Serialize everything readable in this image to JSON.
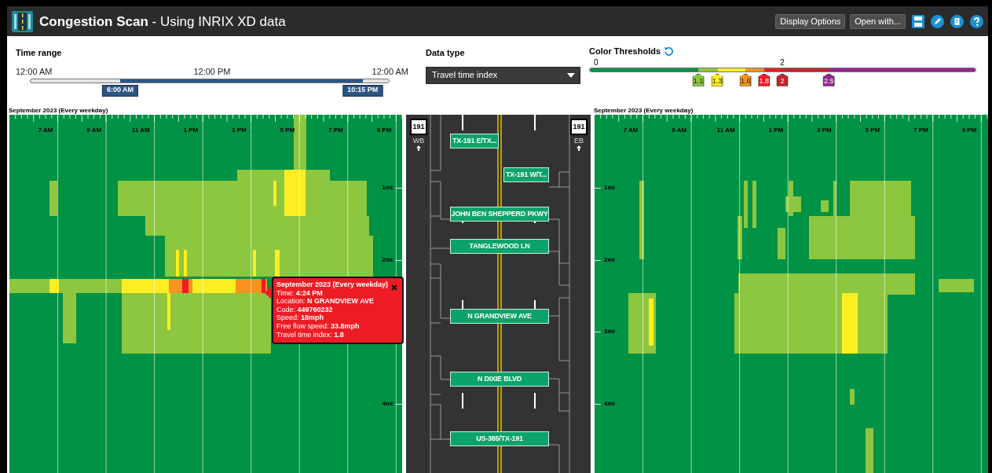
{
  "header": {
    "title": "**Congestion Scan** - Using INRIX XD data",
    "buttons": [
      "Display Options",
      "Open with..."
    ]
  },
  "time_range": {
    "label": "Time range",
    "axis_labels": [
      "12:00 AM",
      "12:00 PM",
      "12:00 AM"
    ],
    "handles": [
      {
        "label": "6:00 AM",
        "level": 0.25
      },
      {
        "label": "10:15 PM",
        "level": 0.927
      }
    ]
  },
  "data_type": {
    "label": "Data type",
    "value": "Travel time index"
  },
  "color_thresholds": {
    "label": "Color Thresholds",
    "ticks": [
      "0",
      "2"
    ],
    "markers": [
      {
        "label": "1.1",
        "color": "#8dc63f"
      },
      {
        "label": "1.3",
        "color": "#fcee21"
      },
      {
        "label": "1.6",
        "color": "#f7931e"
      },
      {
        "label": "1.8",
        "color": "#ed1c24"
      },
      {
        "label": "2",
        "color": "#c1272d"
      },
      {
        "label": "2.5",
        "color": "#93278f"
      }
    ]
  },
  "westbound": {
    "caption": "September 2023 (Every weekday)",
    "hour_labels": [
      "7 AM",
      "9 AM",
      "11 AM",
      "1 PM",
      "3 PM",
      "5 PM",
      "7 PM",
      "9 PM"
    ],
    "mile_labels": [
      "1mi",
      "2mi",
      "4mi"
    ]
  },
  "road": {
    "directions": [
      {
        "shield_number": "191",
        "label": "WB"
      },
      {
        "shield_number": "191",
        "label": "EB"
      }
    ],
    "signs": [
      {
        "label": "TX-191 E/TX...",
        "kind": "westbound"
      },
      {
        "label": "TX-191 W/T...",
        "kind": "eastbound"
      },
      {
        "label": "JOHN BEN SHEPPERD PKWY",
        "kind": "shared"
      },
      {
        "label": "TANGLEWOOD LN",
        "kind": "shared"
      },
      {
        "label": "N GRANDVIEW AVE",
        "kind": "shared"
      },
      {
        "label": "N DIXIE BLVD",
        "kind": "shared"
      },
      {
        "label": "US-385/TX-191",
        "kind": "shared"
      }
    ]
  },
  "eastbound": {
    "caption": "September 2023 (Every weekday)",
    "hour_labels": [
      "7 AM",
      "9 AM",
      "11 AM",
      "1 PM",
      "3 PM",
      "5 PM",
      "7 PM",
      "9 PM"
    ],
    "mile_labels": [
      "1mi",
      "2mi",
      "3mi",
      "4mi"
    ]
  },
  "tooltip": {
    "title": "September 2023 (Every weekday)",
    "lines": [
      "Time: **4:24 PM**",
      "Location: **N GRANDVIEW AVE**",
      "Code: **449760232**",
      "Speed: **18mph**",
      "Free flow speed: **33.8mph**",
      "Travel time index: **1.8**"
    ]
  }
}
